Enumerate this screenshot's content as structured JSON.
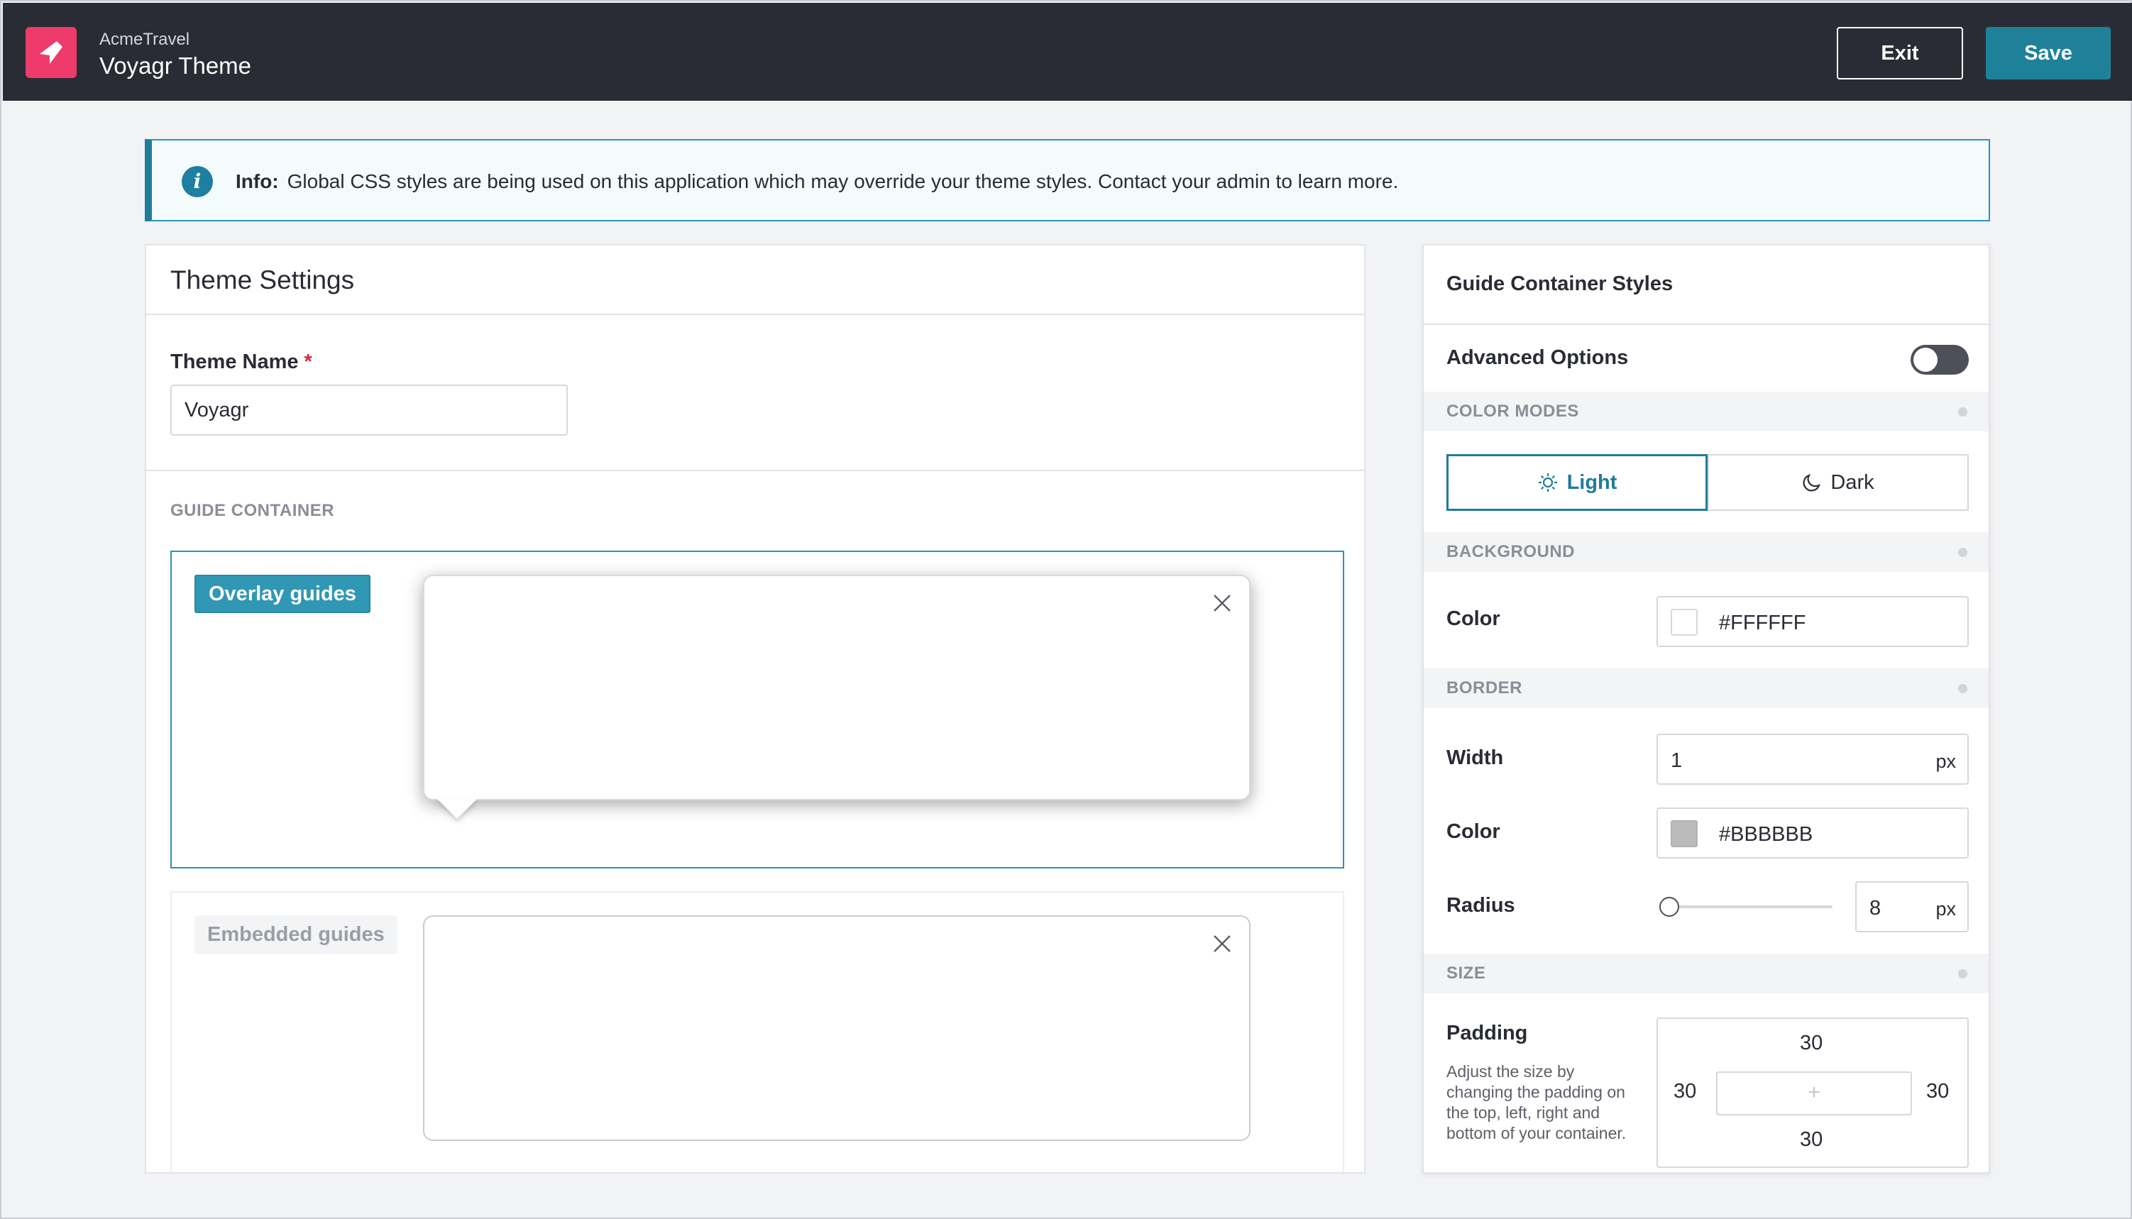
{
  "header": {
    "org_name": "AcmeTravel",
    "app_title": "Voyagr Theme",
    "exit_label": "Exit",
    "save_label": "Save",
    "brand_color": "#ee3b6b",
    "accent_color": "#1f8199"
  },
  "info_banner": {
    "label": "Info:",
    "message": "Global CSS styles are being used on this application which may override your theme styles. Contact your admin to learn more."
  },
  "theme_settings": {
    "title": "Theme Settings",
    "theme_name_label": "Theme Name",
    "required_marker": "*",
    "theme_name_value": "Voyagr",
    "guide_container_caption": "GUIDE CONTAINER",
    "guides": [
      {
        "label": "Overlay guides",
        "selected": true
      },
      {
        "label": "Embedded guides",
        "selected": false
      }
    ]
  },
  "guide_container_styles": {
    "title": "Guide Container Styles",
    "advanced_options_label": "Advanced Options",
    "advanced_options_enabled": false,
    "sections": {
      "color_modes": "COLOR MODES",
      "background": "BACKGROUND",
      "border": "BORDER",
      "size": "SIZE"
    },
    "color_modes": {
      "light_label": "Light",
      "dark_label": "Dark",
      "selected": "Light"
    },
    "background": {
      "color_label": "Color",
      "color_value": "#FFFFFF"
    },
    "border": {
      "width_label": "Width",
      "width_value": "1",
      "width_unit": "px",
      "color_label": "Color",
      "color_value": "#BBBBBB",
      "radius_label": "Radius",
      "radius_value": "8",
      "radius_unit": "px"
    },
    "size": {
      "padding_label": "Padding",
      "padding_help": "Adjust the size by changing the padding on the top, left, right and bottom of your container.",
      "padding_top": "30",
      "padding_left": "30",
      "padding_right": "30",
      "padding_bottom": "30",
      "center_symbol": "+"
    }
  }
}
